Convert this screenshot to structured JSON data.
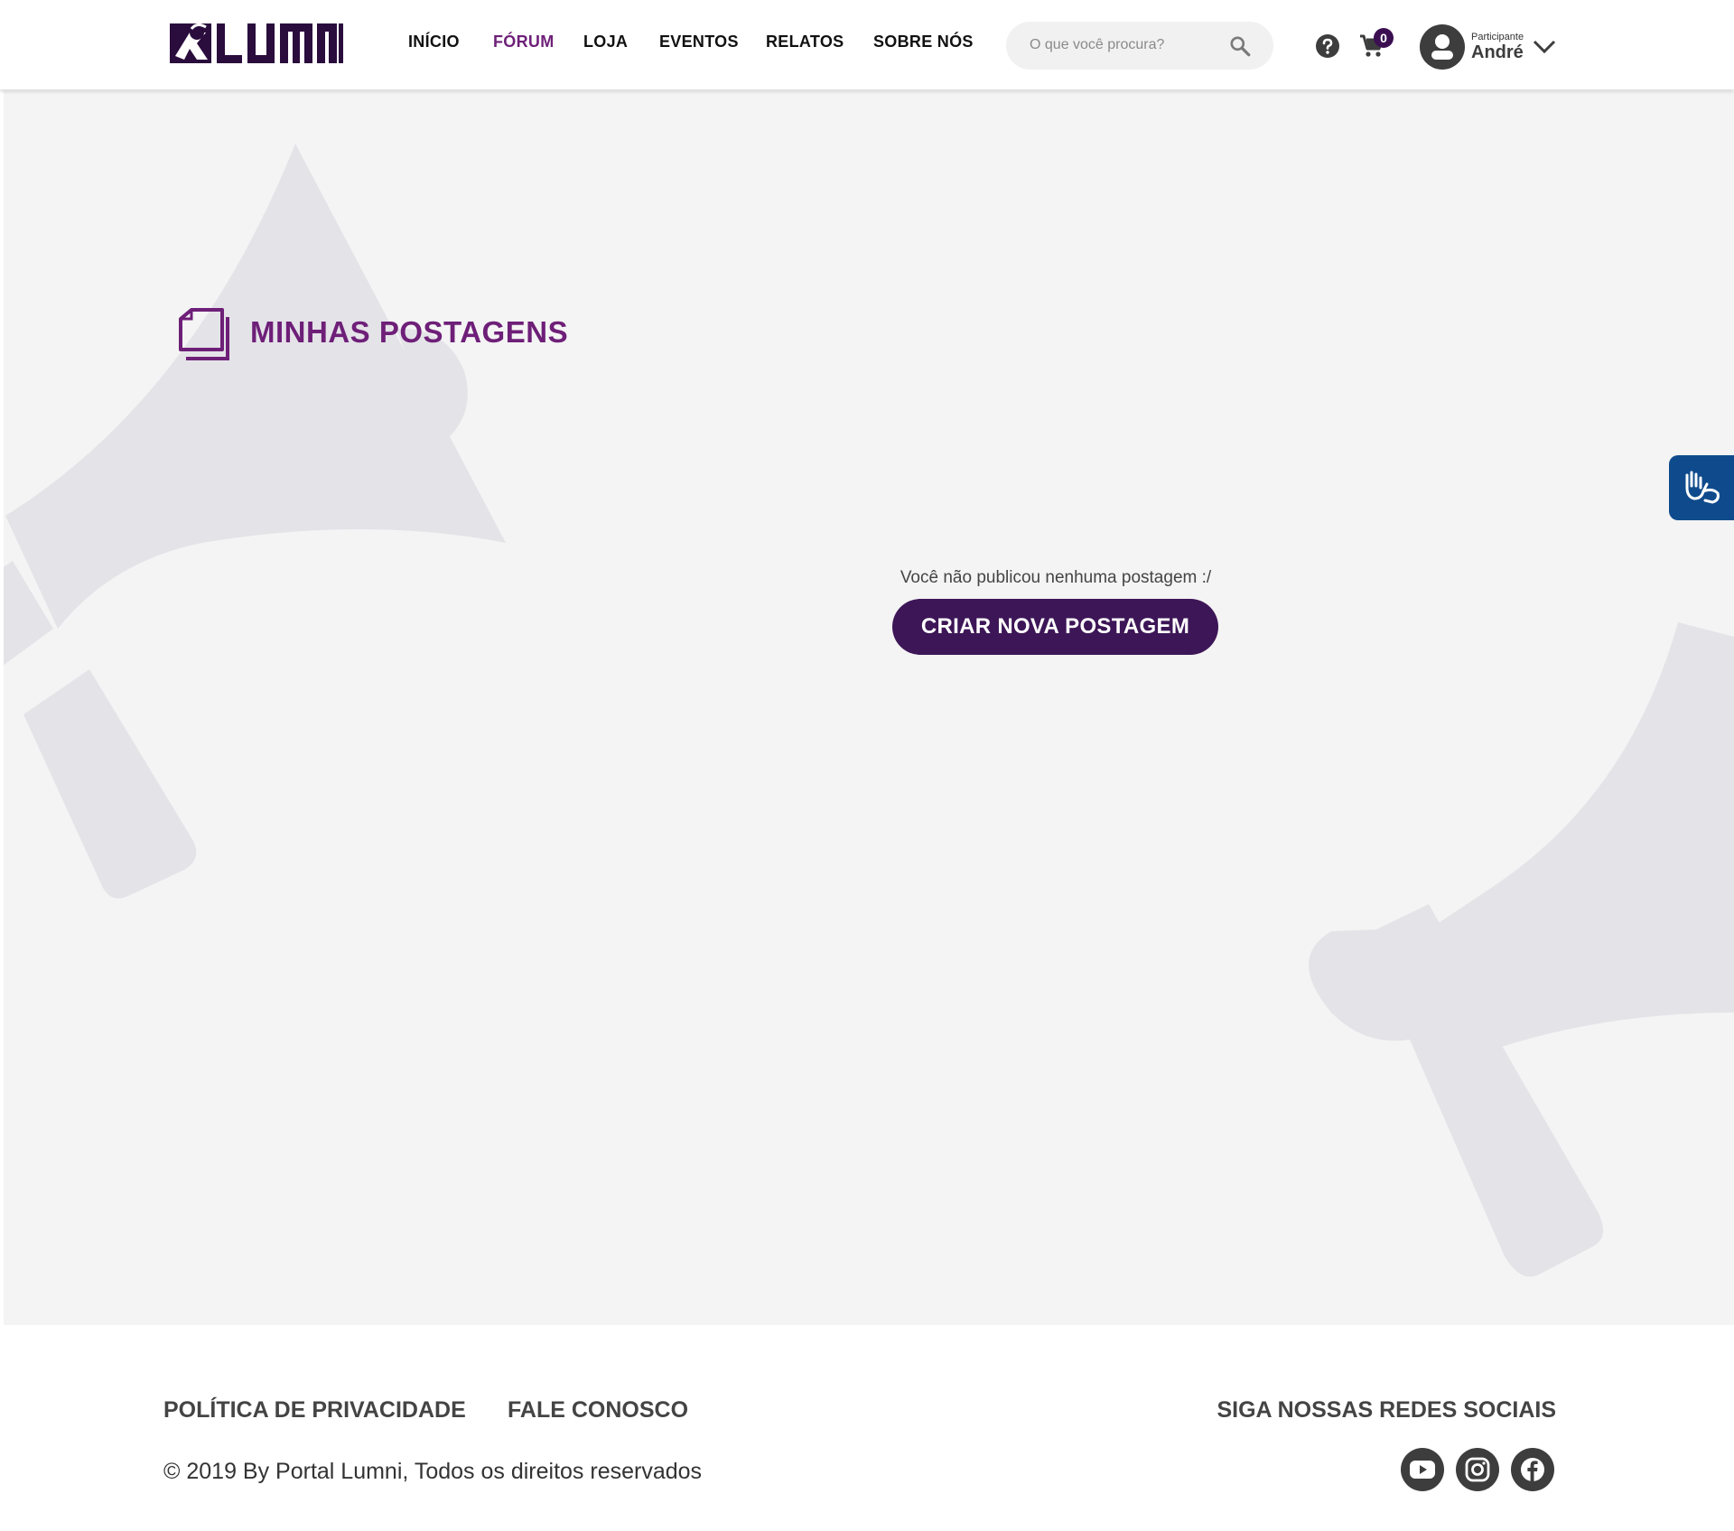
{
  "brand": {
    "name": "LUMNI"
  },
  "nav": {
    "items": [
      {
        "label": "INÍCIO"
      },
      {
        "label": "FÓRUM"
      },
      {
        "label": "LOJA"
      },
      {
        "label": "EVENTOS"
      },
      {
        "label": "RELATOS"
      },
      {
        "label": "SOBRE NÓS"
      }
    ],
    "active_index": 1
  },
  "search": {
    "placeholder": "O que você procura?",
    "icon": "search-icon"
  },
  "cart": {
    "count": "0",
    "icon": "cart-icon"
  },
  "help": {
    "icon": "help-icon"
  },
  "user": {
    "role": "Participante",
    "name": "André"
  },
  "page": {
    "title": "MINHAS POSTAGENS",
    "title_icon": "documents-icon",
    "empty_message": "Você não publicou nenhuma postagem :/",
    "create_button": "CRIAR NOVA POSTAGEM"
  },
  "accessibility": {
    "icon": "sign-language-icon"
  },
  "footer": {
    "links": [
      "POLÍTICA DE PRIVACIDADE",
      "FALE CONOSCO"
    ],
    "copyright": "© 2019 By Portal Lumni, Todos os direitos reservados",
    "social_title": "SIGA NOSSAS REDES SOCIAIS",
    "social": [
      "youtube-icon",
      "instagram-icon",
      "facebook-icon"
    ]
  },
  "colors": {
    "accent": "#6e1f78",
    "button": "#3d1657",
    "background": "#f4f4f4",
    "megaphone": "#e4e3e8",
    "accessibility": "#0f4b8c"
  }
}
